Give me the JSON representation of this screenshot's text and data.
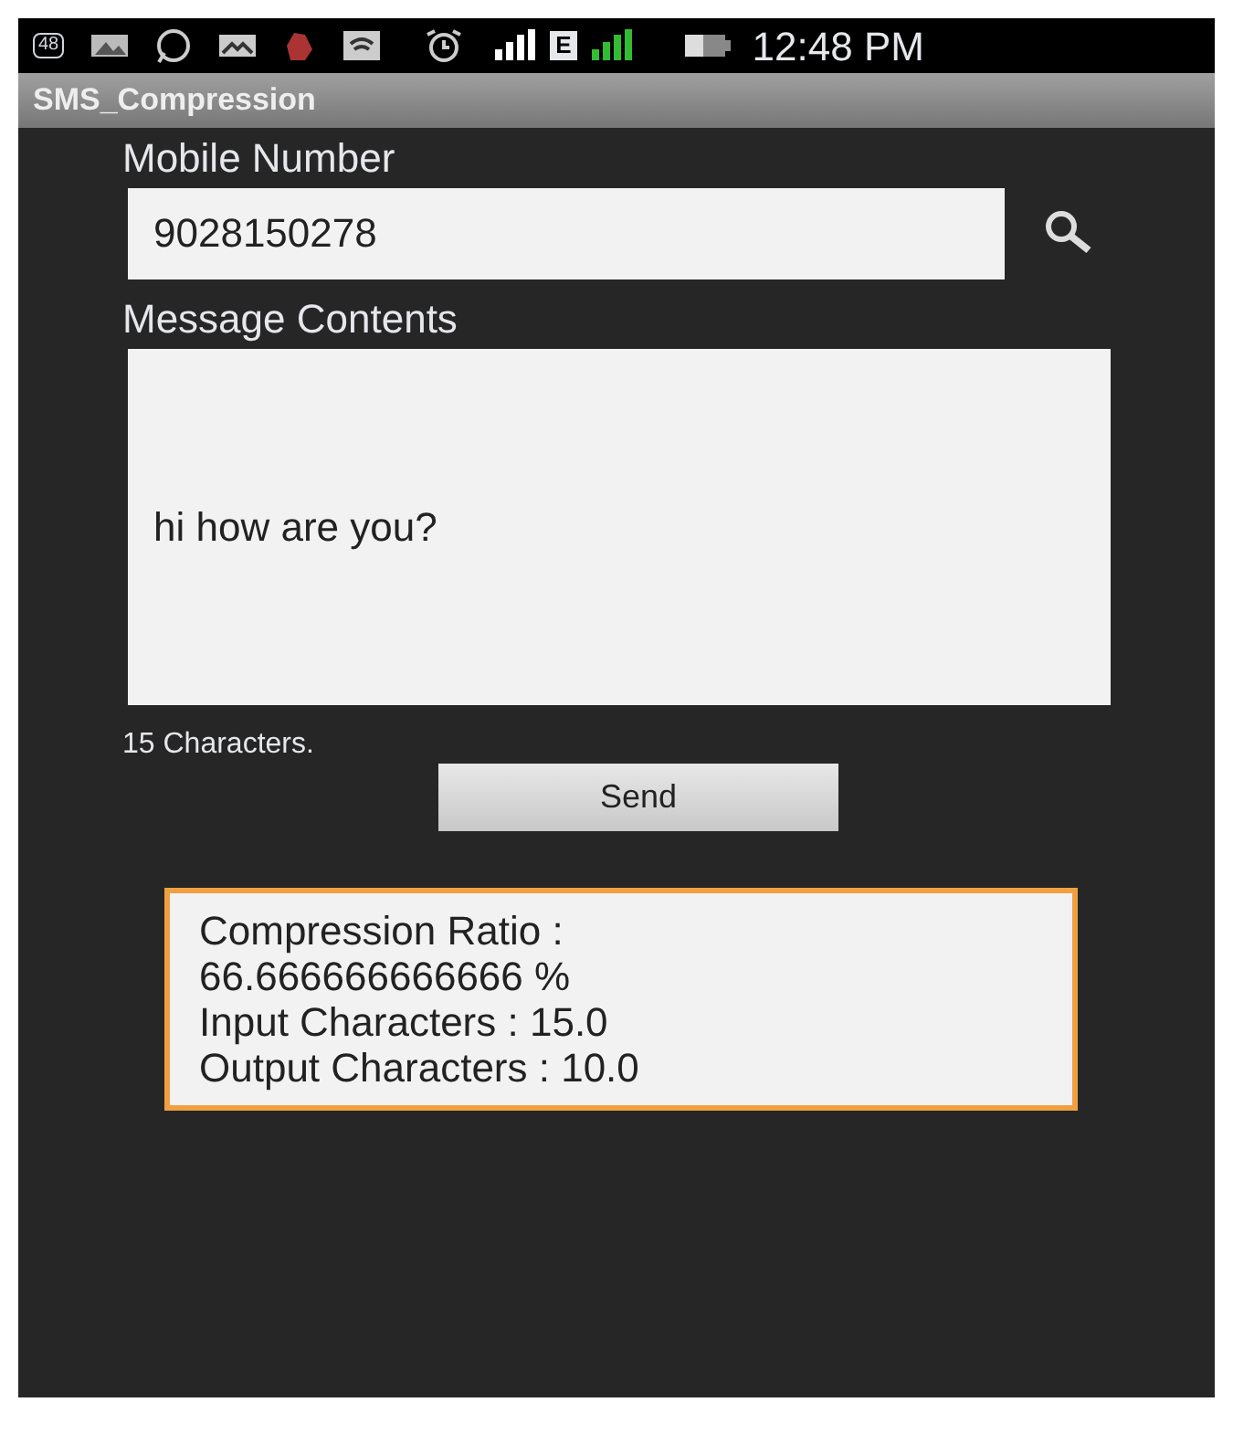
{
  "status_bar": {
    "badge": "48",
    "network_type": "E",
    "time": "12:48 PM"
  },
  "app_title": "SMS_Compression",
  "mobile_number": {
    "label": "Mobile Number",
    "value": "9028150278"
  },
  "message": {
    "label": "Message Contents",
    "value": "hi how are you?"
  },
  "char_count": "15 Characters.",
  "send_button": "Send",
  "result_lines": [
    "Compression Ratio :",
    "66.666666666666 %",
    "Input Characters : 15.0",
    "Output Characters : 10.0"
  ]
}
